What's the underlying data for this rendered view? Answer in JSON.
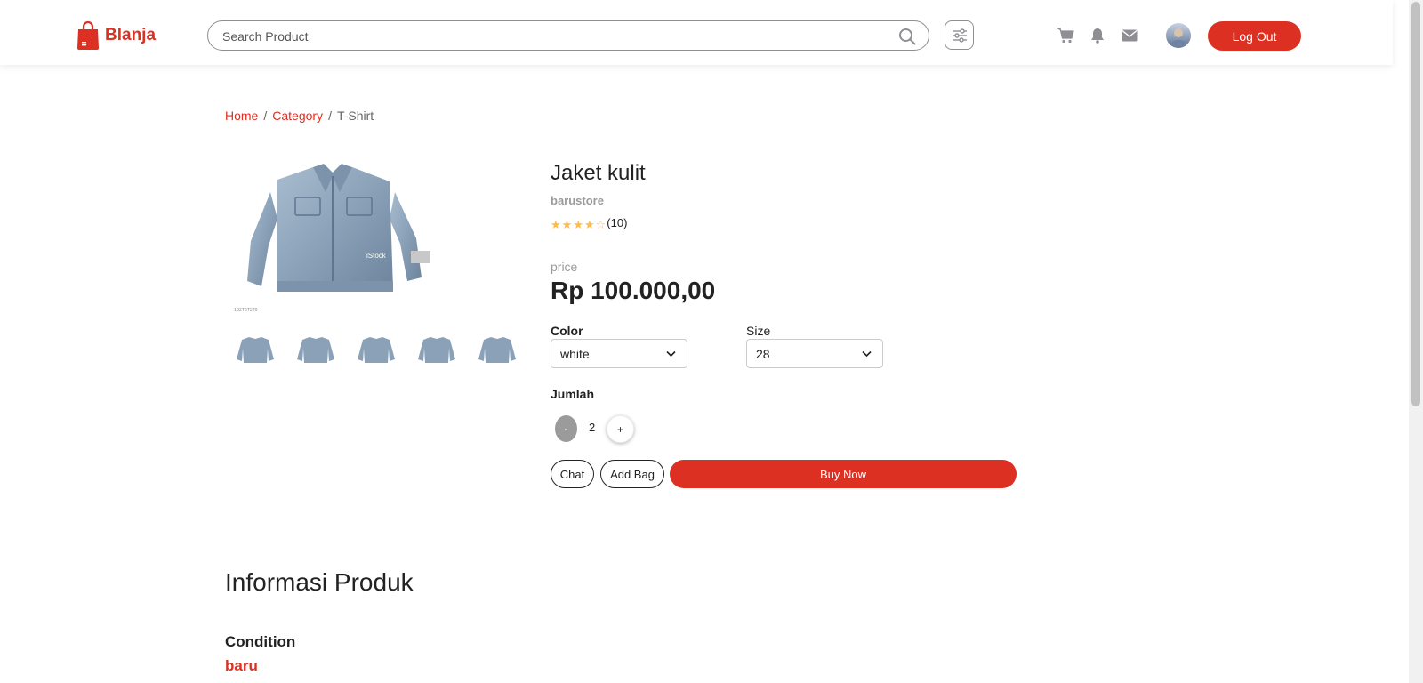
{
  "brand": {
    "name": "Blanja",
    "color": "#DB3022"
  },
  "search": {
    "placeholder": "Search Product",
    "value": ""
  },
  "header": {
    "icons": [
      "search-icon",
      "filter-icon",
      "cart-icon",
      "bell-icon",
      "mail-icon"
    ],
    "logout_label": "Log Out"
  },
  "breadcrumb": {
    "home": "Home",
    "sep": "/",
    "category": "Category",
    "current": "T-Shirt"
  },
  "product": {
    "name": "Jaket kulit",
    "store": "barustore",
    "rating_value": 4,
    "rating_max": 5,
    "rating_count": "(10)",
    "price_label": "price",
    "price": "Rp 100.000,00",
    "image_watermark": "iStock",
    "image_id_label": "1B2T6T5T0",
    "thumbnail_count": 5
  },
  "options": {
    "color_label": "Color",
    "color_value": "white",
    "size_label": "Size",
    "size_value": "28",
    "qty_label": "Jumlah",
    "qty_minus": "-",
    "qty_value": "2",
    "qty_plus": "+"
  },
  "actions": {
    "chat": "Chat",
    "add_bag": "Add Bag",
    "buy_now": "Buy Now"
  },
  "info": {
    "title": "Informasi Produk",
    "condition_label": "Condition",
    "condition_value": "baru"
  }
}
